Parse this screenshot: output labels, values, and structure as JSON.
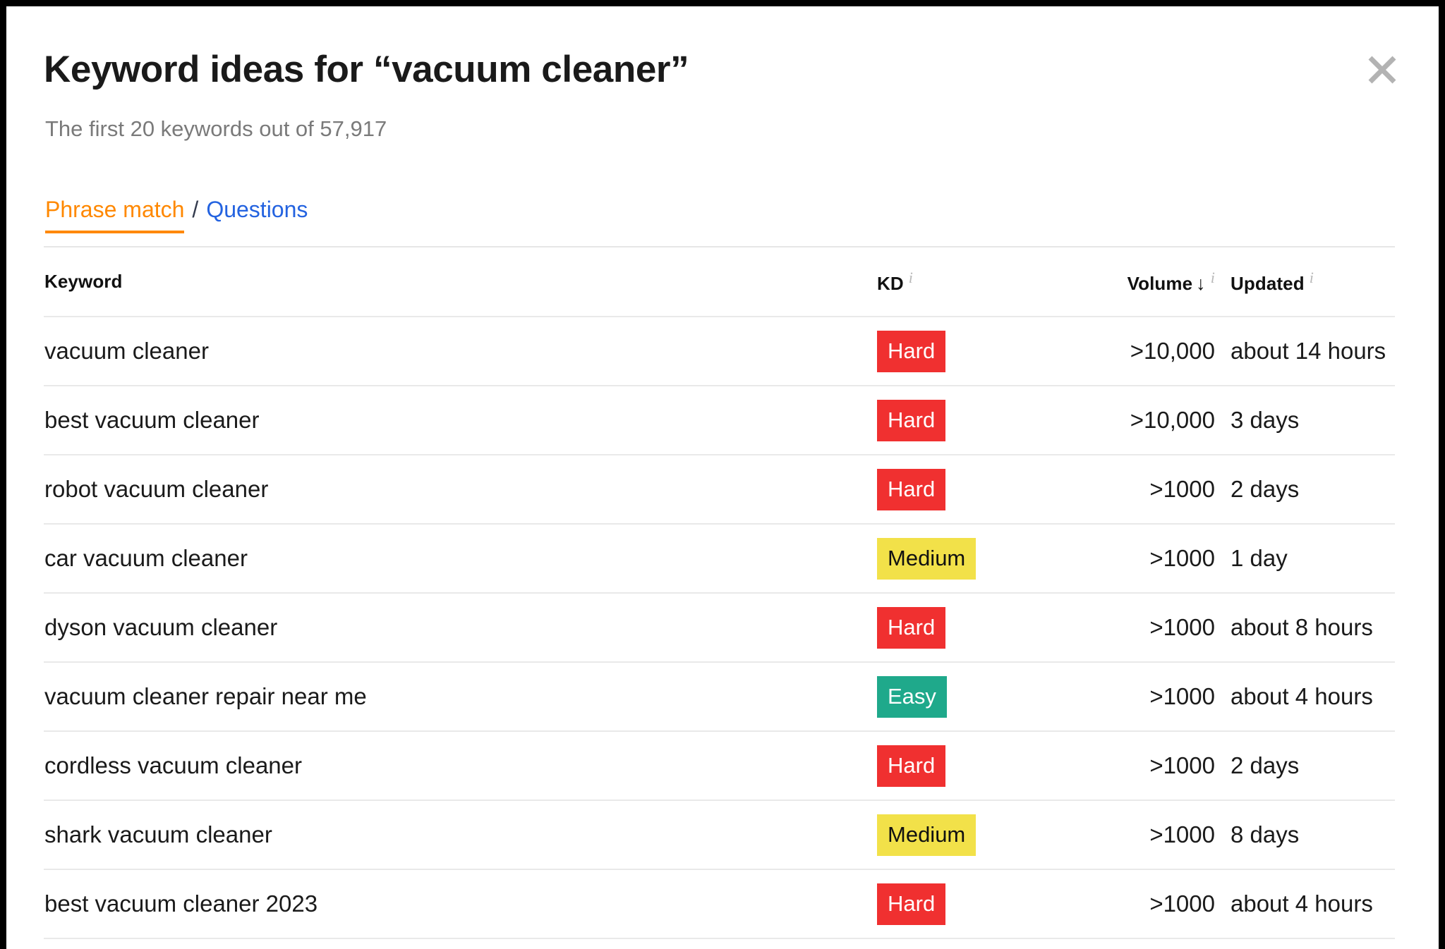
{
  "dialog": {
    "title": "Keyword ideas for “vacuum cleaner”",
    "subtitle": "The first 20 keywords out of 57,917",
    "close_label": "✕"
  },
  "tabs": {
    "active_label": "Phrase match",
    "separator": "/",
    "link_label": "Questions",
    "active_color": "#ff8800",
    "link_color": "#2463e0"
  },
  "table": {
    "headers": {
      "keyword": "Keyword",
      "kd": "KD",
      "volume": "Volume",
      "volume_sort_arrow": "↓",
      "updated": "Updated",
      "info_glyph": "i"
    },
    "rows": [
      {
        "keyword": "vacuum cleaner",
        "kd": "Hard",
        "kd_level": "hard",
        "volume": ">10,000",
        "updated": "about 14 hours"
      },
      {
        "keyword": "best vacuum cleaner",
        "kd": "Hard",
        "kd_level": "hard",
        "volume": ">10,000",
        "updated": "3 days"
      },
      {
        "keyword": "robot vacuum cleaner",
        "kd": "Hard",
        "kd_level": "hard",
        "volume": ">1000",
        "updated": "2 days"
      },
      {
        "keyword": "car vacuum cleaner",
        "kd": "Medium",
        "kd_level": "medium",
        "volume": ">1000",
        "updated": "1 day"
      },
      {
        "keyword": "dyson vacuum cleaner",
        "kd": "Hard",
        "kd_level": "hard",
        "volume": ">1000",
        "updated": "about 8 hours"
      },
      {
        "keyword": "vacuum cleaner repair near me",
        "kd": "Easy",
        "kd_level": "easy",
        "volume": ">1000",
        "updated": "about 4 hours"
      },
      {
        "keyword": "cordless vacuum cleaner",
        "kd": "Hard",
        "kd_level": "hard",
        "volume": ">1000",
        "updated": "2 days"
      },
      {
        "keyword": "shark vacuum cleaner",
        "kd": "Medium",
        "kd_level": "medium",
        "volume": ">1000",
        "updated": "8 days"
      },
      {
        "keyword": "best vacuum cleaner 2023",
        "kd": "Hard",
        "kd_level": "hard",
        "volume": ">1000",
        "updated": "about 4 hours"
      }
    ]
  },
  "colors": {
    "hard": "#f03030",
    "medium": "#f2e149",
    "easy": "#1fa98b",
    "divider": "#e9e9e9",
    "muted_text": "#7a7a7a"
  }
}
